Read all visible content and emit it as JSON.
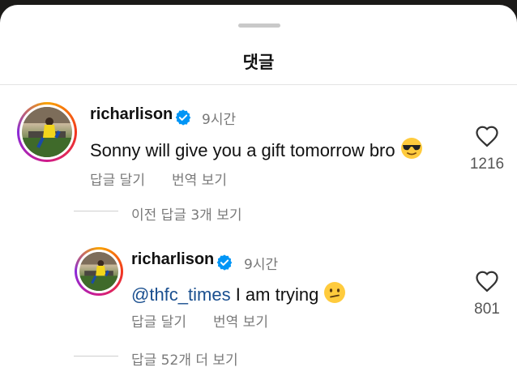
{
  "sheet": {
    "title": "댓글"
  },
  "comments": [
    {
      "username": "richarlison",
      "time": "9시간",
      "text": "Sonny will give you a gift tomorrow bro",
      "emoji": "sunglasses-emoji",
      "reply_label": "답글 달기",
      "translate_label": "번역 보기",
      "likes": "1216",
      "previous_replies_label": "이전 답글 3개 보기"
    }
  ],
  "replies": [
    {
      "username": "richarlison",
      "time": "9시간",
      "mention": "@thfc_times",
      "text": " I am trying",
      "emoji": "confused-emoji",
      "reply_label": "답글 달기",
      "translate_label": "번역 보기",
      "likes": "801",
      "more_replies_label": "답글 52개 더 보기"
    }
  ],
  "colors": {
    "verified": "#0095f6",
    "mention": "#1a4f8f",
    "muted": "#7a7a7a"
  }
}
